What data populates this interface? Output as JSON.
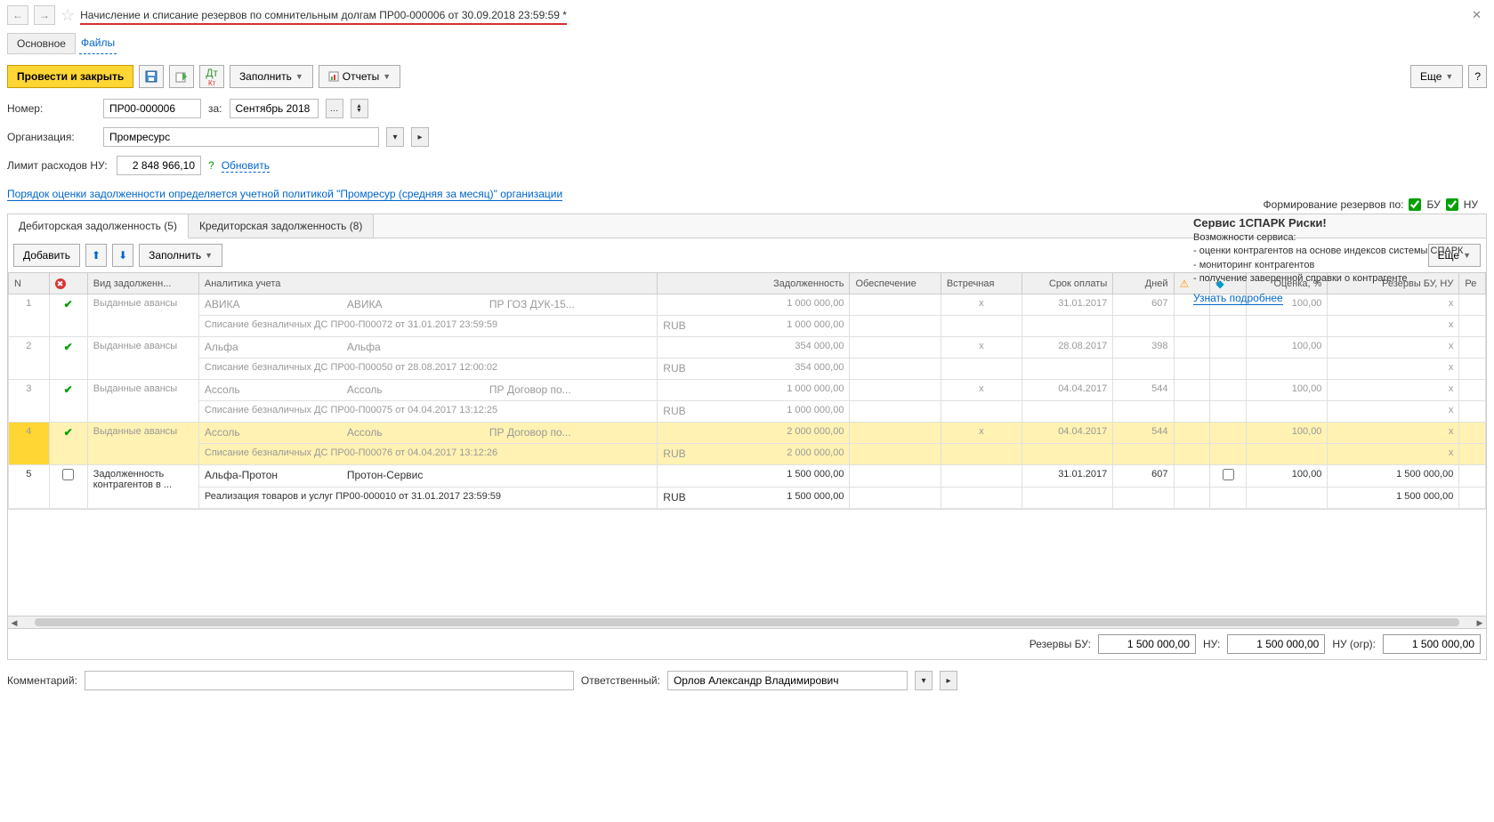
{
  "header": {
    "title": "Начисление и списание резервов по сомнительным долгам ПР00-000006 от 30.09.2018 23:59:59 *"
  },
  "nav": {
    "main": "Основное",
    "files": "Файлы"
  },
  "toolbar": {
    "post_close": "Провести и закрыть",
    "fill": "Заполнить",
    "reports": "Отчеты",
    "more": "Еще"
  },
  "form": {
    "number_label": "Номер:",
    "number": "ПР00-000006",
    "for_label": "за:",
    "period": "Сентябрь 2018",
    "org_label": "Организация:",
    "org": "Промресурс",
    "limit_label": "Лимит расходов НУ:",
    "limit": "2 848 966,10",
    "refresh": "Обновить",
    "policy": "Порядок оценки задолженности определяется учетной политикой \"Промресур (средняя за месяц)\" организации"
  },
  "reserves": {
    "label": "Формирование резервов по:",
    "bu": "БУ",
    "nu": "НУ"
  },
  "service": {
    "title": "Сервис 1СПАРК Риски!",
    "sub": "Возможности сервиса:",
    "l1": "- оценки контрагентов на основе индексов системы СПАРК",
    "l2": "- мониторинг контрагентов",
    "l3": "- получение заверенной справки о контрагенте",
    "more": "Узнать подробнее"
  },
  "tabs": {
    "deb": "Дебиторская задолженность (5)",
    "cred": "Кредиторская задолженность (8)"
  },
  "subtb": {
    "add": "Добавить",
    "fill": "Заполнить",
    "more": "Еще"
  },
  "cols": {
    "n": "N",
    "type": "Вид задолженн...",
    "an": "Аналитика учета",
    "debt": "Задолженность",
    "sec": "Обеспечение",
    "cnt": "Встречная",
    "date": "Срок оплаты",
    "days": "Дней",
    "est": "Оценка, %",
    "res": "Резервы БУ, НУ",
    "re": "Ре"
  },
  "rows": [
    {
      "n": "1",
      "chk": true,
      "type": "Выданные авансы",
      "a1": "АВИКА",
      "a2": "АВИКА",
      "a3": "ПР ГОЗ ДУК-15...",
      "amt": "1 000 000,00",
      "doc": "Списание безналичных ДС ПР00-П00072 от 31.01.2017 23:59:59",
      "cur": "RUB",
      "amt2": "1 000 000,00",
      "cnt": "x",
      "date": "31.01.2017",
      "days": "607",
      "est": "100,00",
      "res": "x",
      "res2": "x"
    },
    {
      "n": "2",
      "chk": true,
      "type": "Выданные авансы",
      "a1": "Альфа",
      "a2": "Альфа",
      "a3": "",
      "amt": "354 000,00",
      "doc": "Списание безналичных ДС ПР00-П00050 от 28.08.2017 12:00:02",
      "cur": "RUB",
      "amt2": "354 000,00",
      "cnt": "x",
      "date": "28.08.2017",
      "days": "398",
      "est": "100,00",
      "res": "x",
      "res2": "x"
    },
    {
      "n": "3",
      "chk": true,
      "type": "Выданные авансы",
      "a1": "Ассоль",
      "a2": "Ассоль",
      "a3": "ПР Договор по...",
      "amt": "1 000 000,00",
      "doc": "Списание безналичных ДС ПР00-П00075 от 04.04.2017 13:12:25",
      "cur": "RUB",
      "amt2": "1 000 000,00",
      "cnt": "x",
      "date": "04.04.2017",
      "days": "544",
      "est": "100,00",
      "res": "x",
      "res2": "x"
    },
    {
      "n": "4",
      "chk": true,
      "type": "Выданные авансы",
      "a1": "Ассоль",
      "a2": "Ассоль",
      "a3": "ПР Договор по...",
      "amt": "2 000 000,00",
      "doc": "Списание безналичных ДС ПР00-П00076 от 04.04.2017 13:12:26",
      "cur": "RUB",
      "amt2": "2 000 000,00",
      "cnt": "x",
      "date": "04.04.2017",
      "days": "544",
      "est": "100,00",
      "res": "x",
      "res2": "x",
      "sel": true
    },
    {
      "n": "5",
      "chk": false,
      "type": "Задолженность контрагентов в ...",
      "a1": "Альфа-Протон",
      "a2": "Протон-Сервис",
      "a3": "",
      "amt": "1 500 000,00",
      "doc": "Реализация товаров и услуг ПР00-000010 от 31.01.2017 23:59:59",
      "cur": "RUB",
      "amt2": "1 500 000,00",
      "cnt": "",
      "date": "31.01.2017",
      "days": "607",
      "est": "100,00",
      "res": "1 500 000,00",
      "res2": "1 500 000,00",
      "normal": true,
      "showbox": true
    }
  ],
  "totals": {
    "bu_label": "Резервы БУ:",
    "bu": "1 500 000,00",
    "nu_label": "НУ:",
    "nu": "1 500 000,00",
    "nuo_label": "НУ (огр):",
    "nuo": "1 500 000,00"
  },
  "footer": {
    "comment_label": "Комментарий:",
    "resp_label": "Ответственный:",
    "resp": "Орлов Александр Владимирович"
  }
}
